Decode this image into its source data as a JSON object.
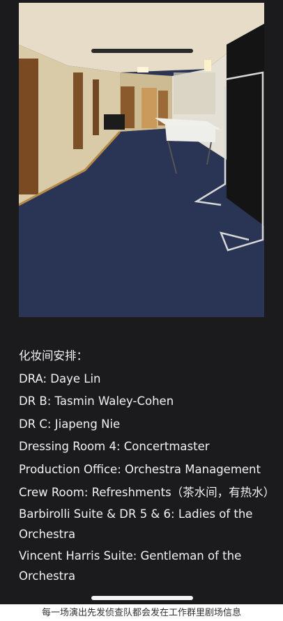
{
  "note": {
    "heading": "化妆间安排：",
    "lines": [
      "DRA: Daye Lin",
      "DR B: Tasmin Waley-Cohen",
      "DR C: Jiapeng Nie",
      "Dressing Room 4: Concertmaster",
      "Production Office: Orchestra Management",
      "Crew Room: Refreshments（茶水间，有热水）",
      "Barbirolli Suite & DR 5 & 6: Ladies of the Orchestra",
      "Vincent Harris Suite: Gentleman of the Orchestra"
    ]
  },
  "caption": "每一场演出先发侦查队都会发在工作群里剧场信息",
  "colors": {
    "background": "#1b1b1d",
    "text": "#f2f2f2",
    "caption": "#333333"
  }
}
